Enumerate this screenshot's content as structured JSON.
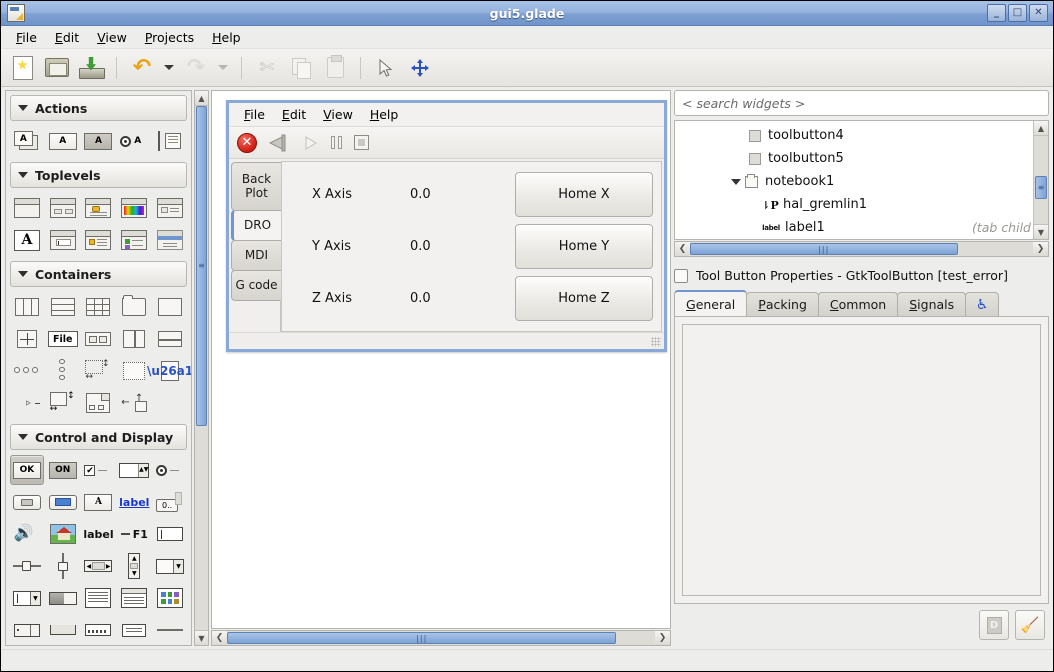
{
  "window": {
    "title": "gui5.glade",
    "icon": "glade-file-icon",
    "controls": [
      {
        "name": "minimize-button",
        "glyph": "_"
      },
      {
        "name": "maximize-button",
        "glyph": "□"
      },
      {
        "name": "close-button",
        "glyph": "✕"
      }
    ]
  },
  "menubar": {
    "items": [
      {
        "label": "File",
        "mnemonic": "F"
      },
      {
        "label": "Edit",
        "mnemonic": "E"
      },
      {
        "label": "View",
        "mnemonic": "V"
      },
      {
        "label": "Projects",
        "mnemonic": "P"
      },
      {
        "label": "Help",
        "mnemonic": "H"
      }
    ]
  },
  "toolbar": {
    "buttons": [
      {
        "name": "new-project-button",
        "icon": "new-document-icon",
        "enabled": true
      },
      {
        "name": "open-project-button",
        "icon": "open-folder-icon",
        "enabled": true
      },
      {
        "name": "save-project-button",
        "icon": "save-disk-icon",
        "enabled": true
      },
      {
        "name": "undo-button",
        "icon": "undo-arrow-icon",
        "enabled": true
      },
      {
        "name": "undo-dropdown-button",
        "icon": "chevron-down-icon",
        "enabled": true
      },
      {
        "name": "redo-button",
        "icon": "redo-arrow-icon",
        "enabled": false
      },
      {
        "name": "redo-dropdown-button",
        "icon": "chevron-down-icon",
        "enabled": false
      },
      {
        "name": "cut-button",
        "icon": "scissors-icon",
        "enabled": false
      },
      {
        "name": "copy-button",
        "icon": "copy-pages-icon",
        "enabled": false
      },
      {
        "name": "paste-button",
        "icon": "clipboard-icon",
        "enabled": false
      },
      {
        "name": "select-pointer-button",
        "icon": "pointer-arrow-icon",
        "enabled": true
      },
      {
        "name": "drag-resize-button",
        "icon": "move-cross-icon",
        "enabled": true
      }
    ]
  },
  "palette": {
    "sections": [
      {
        "name": "Actions",
        "expanded": true,
        "items": [
          {
            "icon": "action-group-icon",
            "selected": false
          },
          {
            "icon": "action-icon",
            "selected": false
          },
          {
            "icon": "toggle-action-icon",
            "selected": false
          },
          {
            "icon": "radio-action-icon",
            "selected": false
          },
          {
            "icon": "recent-action-icon",
            "selected": false
          }
        ]
      },
      {
        "name": "Toplevels",
        "expanded": true,
        "items": [
          {
            "icon": "window-icon",
            "selected": false
          },
          {
            "icon": "dialog-icon",
            "selected": false
          },
          {
            "icon": "message-dialog-icon",
            "selected": false
          },
          {
            "icon": "color-selection-dialog-icon",
            "selected": false
          },
          {
            "icon": "file-chooser-dialog-icon",
            "selected": false
          },
          {
            "icon": "font-selection-dialog-icon",
            "selected": false
          },
          {
            "icon": "input-dialog-icon",
            "selected": false
          },
          {
            "icon": "about-dialog-icon",
            "selected": false
          },
          {
            "icon": "assistant-icon",
            "selected": false
          },
          {
            "icon": "offscreen-window-icon",
            "selected": false
          }
        ]
      },
      {
        "name": "Containers",
        "expanded": true,
        "items": [
          {
            "icon": "hbox-icon",
            "selected": false
          },
          {
            "icon": "vbox-icon",
            "selected": false
          },
          {
            "icon": "table-icon",
            "selected": false
          },
          {
            "icon": "notebook-icon",
            "selected": false
          },
          {
            "icon": "frame-icon",
            "selected": false
          },
          {
            "icon": "alignment-icon",
            "selected": false
          },
          {
            "icon": "file-chooser-widget-icon",
            "selected": false
          },
          {
            "icon": "hbutton-box-icon",
            "selected": false
          },
          {
            "icon": "hpaned-icon",
            "selected": false
          },
          {
            "icon": "vpaned-icon",
            "selected": false
          },
          {
            "icon": "hbutton-row-icon",
            "selected": false
          },
          {
            "icon": "vbutton-box-icon",
            "selected": false
          },
          {
            "icon": "scrolled-window-icon",
            "selected": false
          },
          {
            "icon": "viewport-icon",
            "selected": false
          },
          {
            "icon": "event-box-icon",
            "selected": false
          },
          {
            "icon": "expander-icon",
            "selected": false
          },
          {
            "icon": "size-group-icon",
            "selected": false
          },
          {
            "icon": "layout-icon",
            "selected": false
          },
          {
            "icon": "fixed-icon",
            "selected": false
          }
        ]
      },
      {
        "name": "Control and Display",
        "expanded": true,
        "items": [
          {
            "icon": "button-icon",
            "label": "OK",
            "selected": true
          },
          {
            "icon": "toggle-button-icon",
            "label": "ON",
            "selected": false
          },
          {
            "icon": "check-button-icon",
            "selected": false
          },
          {
            "icon": "spin-button-icon",
            "selected": false
          },
          {
            "icon": "radio-button-icon",
            "selected": false
          },
          {
            "icon": "file-chooser-button-icon",
            "selected": false
          },
          {
            "icon": "color-button-icon",
            "selected": false
          },
          {
            "icon": "font-button-icon",
            "selected": false
          },
          {
            "icon": "link-button-icon",
            "label": "label",
            "selected": false
          },
          {
            "icon": "scale-button-icon",
            "label": "0..",
            "selected": false
          },
          {
            "icon": "volume-button-icon",
            "selected": false
          },
          {
            "icon": "image-icon",
            "selected": false
          },
          {
            "icon": "label-icon",
            "label": "label",
            "selected": false
          },
          {
            "icon": "accel-label-icon",
            "label": "F1",
            "selected": false
          },
          {
            "icon": "entry-icon",
            "selected": false
          },
          {
            "icon": "hscale-icon",
            "selected": false
          },
          {
            "icon": "vscale-icon",
            "selected": false
          },
          {
            "icon": "hscrollbar-icon",
            "selected": false
          },
          {
            "icon": "vscrollbar-icon",
            "selected": false
          },
          {
            "icon": "combo-box-icon",
            "selected": false
          },
          {
            "icon": "combo-box-entry-icon",
            "selected": false
          },
          {
            "icon": "progress-bar-icon",
            "selected": false
          },
          {
            "icon": "text-view-icon",
            "selected": false
          },
          {
            "icon": "tree-view-icon",
            "selected": false
          },
          {
            "icon": "icon-view-icon",
            "selected": false
          },
          {
            "icon": "statusbar-icon",
            "selected": false
          },
          {
            "icon": "toolbar-icon",
            "selected": false
          },
          {
            "icon": "drawing-area-icon",
            "selected": false
          },
          {
            "icon": "calendar-icon",
            "selected": false
          },
          {
            "icon": "separator-icon",
            "selected": false
          }
        ]
      }
    ],
    "scrollbar": {
      "name": "palette-vertical-scrollbar"
    }
  },
  "canvas": {
    "design_window": {
      "menubar": [
        {
          "label": "File",
          "mnemonic": "F"
        },
        {
          "label": "Edit",
          "mnemonic": "E"
        },
        {
          "label": "View",
          "mnemonic": "V"
        },
        {
          "label": "Help",
          "mnemonic": "H"
        }
      ],
      "toolbar": [
        {
          "name": "estop-toggle-button",
          "icon": "red-stop-circle-icon",
          "enabled": true
        },
        {
          "name": "machine-power-button",
          "icon": "power-switch-icon",
          "enabled": true
        },
        {
          "name": "run-button",
          "icon": "play-triangle-icon",
          "enabled": false
        },
        {
          "name": "pause-button",
          "icon": "pause-bars-icon",
          "enabled": true
        },
        {
          "name": "stop-button",
          "icon": "stop-square-icon",
          "enabled": true
        }
      ],
      "tabs": [
        {
          "label": "Back Plot",
          "active": false
        },
        {
          "label": "DRO",
          "active": true
        },
        {
          "label": "MDI",
          "active": false
        },
        {
          "label": "G code",
          "active": false
        }
      ],
      "dro_rows": [
        {
          "axis": "X Axis",
          "value": "0.0",
          "button": "Home X"
        },
        {
          "axis": "Y Axis",
          "value": "0.0",
          "button": "Home Y"
        },
        {
          "axis": "Z Axis",
          "value": "0.0",
          "button": "Home Z"
        }
      ]
    },
    "hscrollbar": {
      "name": "canvas-horizontal-scrollbar"
    }
  },
  "inspector": {
    "search": {
      "placeholder": "< search widgets >",
      "value": ""
    },
    "tree": [
      {
        "label": "toolbutton4",
        "icon": "toolbutton-icon",
        "indent": 2,
        "expander": false,
        "suffix": ""
      },
      {
        "label": "toolbutton5",
        "icon": "toolbutton-icon",
        "indent": 2,
        "expander": false,
        "suffix": ""
      },
      {
        "label": "notebook1",
        "icon": "notebook-icon",
        "indent": 1,
        "expander": true,
        "suffix": ""
      },
      {
        "label": "hal_gremlin1",
        "icon": "gremlin-icon",
        "indent": 2,
        "expander": false,
        "suffix": ""
      },
      {
        "label": "label1",
        "icon": "label-icon",
        "indent": 2,
        "expander": false,
        "suffix": "(tab child"
      }
    ],
    "properties": {
      "title": "Tool Button Properties - GtkToolButton [test_error]",
      "tabs": [
        {
          "label": "General",
          "mnemonic": "G",
          "active": true
        },
        {
          "label": "Packing",
          "mnemonic": "P",
          "active": false
        },
        {
          "label": "Common",
          "mnemonic": "C",
          "active": false
        },
        {
          "label": "Signals",
          "mnemonic": "S",
          "active": false
        },
        {
          "label": "",
          "icon": "accessibility-icon",
          "active": false
        }
      ]
    },
    "footer_buttons": [
      {
        "name": "documentation-button",
        "icon": "devhelp-doc-icon",
        "enabled": false
      },
      {
        "name": "clear-properties-button",
        "icon": "broom-icon",
        "enabled": false
      }
    ]
  },
  "colors": {
    "titlebar_start": "#a8c2e6",
    "titlebar_end": "#6f94ca",
    "chrome": "#ededeb",
    "selection_blue": "#6f96cf",
    "scrollbar_thumb": "#7fa3d6",
    "estop_red": "#cf1f16"
  }
}
